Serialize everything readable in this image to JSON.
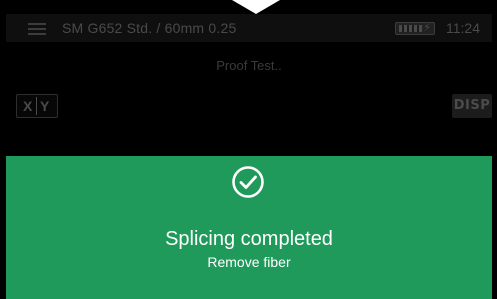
{
  "status_bar": {
    "splice_program": "SM G652 Std. / 60mm 0.25",
    "time": "11:24",
    "menu_icon": "hamburger-menu-icon",
    "battery_icon": "battery-charging-icon"
  },
  "process": {
    "label": "Proof Test.."
  },
  "toolbar": {
    "xy_x": "X",
    "xy_y": "Y",
    "disp_label": "DISP"
  },
  "result": {
    "icon": "check-circle-icon",
    "title": "Splicing completed",
    "subtitle": "Remove fiber",
    "color": "#1f9a5b"
  }
}
